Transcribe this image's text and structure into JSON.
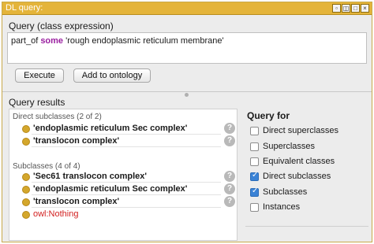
{
  "window": {
    "title": "DL query:"
  },
  "query": {
    "label": "Query (class expression)",
    "expression_prefix": "part_of ",
    "expression_keyword": "some",
    "expression_suffix": " 'rough endoplasmic reticulum membrane'"
  },
  "buttons": {
    "execute": "Execute",
    "add_to_ontology": "Add to ontology"
  },
  "results": {
    "label": "Query results",
    "direct_subclasses": {
      "header": "Direct subclasses (2 of 2)",
      "items": [
        "'endoplasmic reticulum Sec complex'",
        "'translocon complex'"
      ]
    },
    "subclasses": {
      "header": "Subclasses (4 of 4)",
      "items": [
        "'Sec61 translocon complex'",
        "'endoplasmic reticulum Sec complex'",
        "'translocon complex'",
        "owl:Nothing"
      ]
    },
    "help_glyph": "?"
  },
  "query_for": {
    "label": "Query for",
    "options": [
      {
        "label": "Direct superclasses",
        "checked": false
      },
      {
        "label": "Superclasses",
        "checked": false
      },
      {
        "label": "Equivalent classes",
        "checked": false
      },
      {
        "label": "Direct subclasses",
        "checked": true
      },
      {
        "label": "Subclasses",
        "checked": true
      },
      {
        "label": "Instances",
        "checked": false
      }
    ]
  }
}
